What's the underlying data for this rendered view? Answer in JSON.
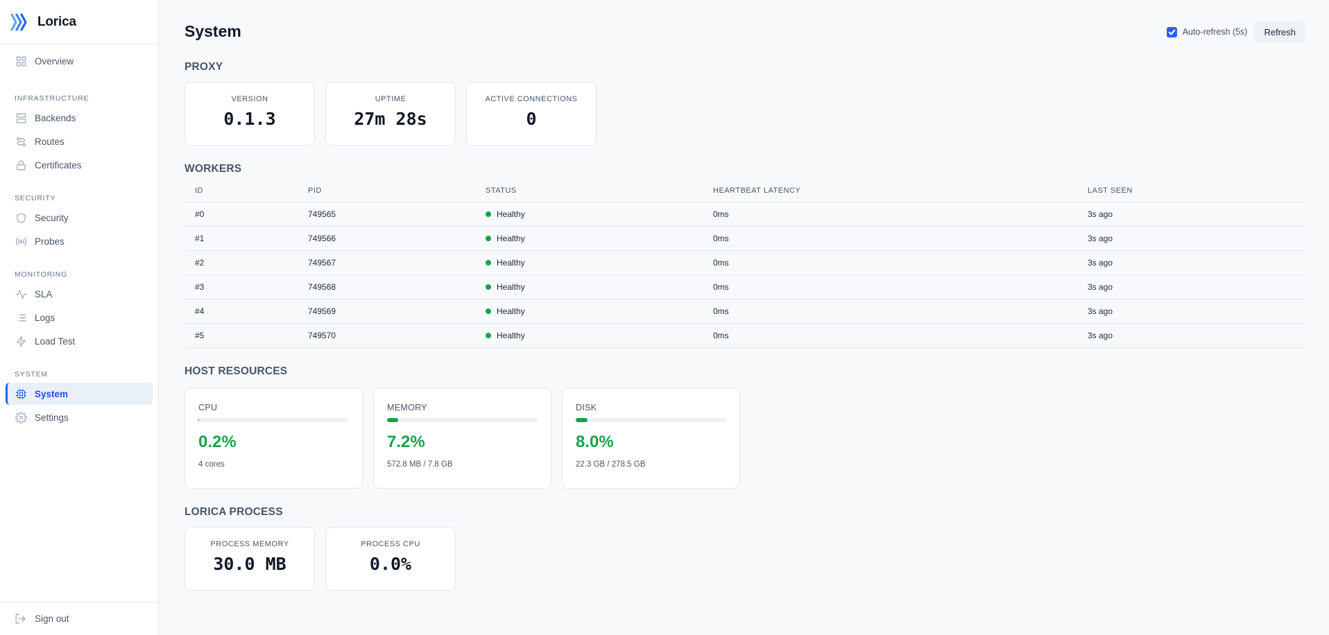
{
  "brand": {
    "name": "Lorica"
  },
  "sidebar": {
    "top": [
      {
        "label": "Overview",
        "icon": "grid-icon"
      }
    ],
    "groups": [
      {
        "label": "INFRASTRUCTURE",
        "items": [
          {
            "label": "Backends",
            "icon": "server-icon"
          },
          {
            "label": "Routes",
            "icon": "route-icon"
          },
          {
            "label": "Certificates",
            "icon": "lock-icon"
          }
        ]
      },
      {
        "label": "SECURITY",
        "items": [
          {
            "label": "Security",
            "icon": "shield-icon"
          },
          {
            "label": "Probes",
            "icon": "broadcast-icon"
          }
        ]
      },
      {
        "label": "MONITORING",
        "items": [
          {
            "label": "SLA",
            "icon": "activity-icon"
          },
          {
            "label": "Logs",
            "icon": "list-icon"
          },
          {
            "label": "Load Test",
            "icon": "bolt-icon"
          }
        ]
      },
      {
        "label": "SYSTEM",
        "items": [
          {
            "label": "System",
            "icon": "chip-icon",
            "active": true
          },
          {
            "label": "Settings",
            "icon": "gear-icon"
          }
        ]
      }
    ],
    "signout": "Sign out"
  },
  "header": {
    "title": "System",
    "auto_refresh_label": "Auto-refresh (5s)",
    "auto_refresh_checked": true,
    "refresh_label": "Refresh"
  },
  "proxy": {
    "title": "PROXY",
    "cards": [
      {
        "label": "VERSION",
        "value": "0.1.3"
      },
      {
        "label": "UPTIME",
        "value": "27m 28s"
      },
      {
        "label": "ACTIVE CONNECTIONS",
        "value": "0"
      }
    ]
  },
  "workers": {
    "title": "WORKERS",
    "columns": [
      "ID",
      "PID",
      "STATUS",
      "HEARTBEAT LATENCY",
      "LAST SEEN"
    ],
    "rows": [
      {
        "id": "#0",
        "pid": "749565",
        "status": "Healthy",
        "latency": "0ms",
        "last_seen": "3s ago"
      },
      {
        "id": "#1",
        "pid": "749566",
        "status": "Healthy",
        "latency": "0ms",
        "last_seen": "3s ago"
      },
      {
        "id": "#2",
        "pid": "749567",
        "status": "Healthy",
        "latency": "0ms",
        "last_seen": "3s ago"
      },
      {
        "id": "#3",
        "pid": "749568",
        "status": "Healthy",
        "latency": "0ms",
        "last_seen": "3s ago"
      },
      {
        "id": "#4",
        "pid": "749569",
        "status": "Healthy",
        "latency": "0ms",
        "last_seen": "3s ago"
      },
      {
        "id": "#5",
        "pid": "749570",
        "status": "Healthy",
        "latency": "0ms",
        "last_seen": "3s ago"
      }
    ],
    "status_color": "#16a34a"
  },
  "host": {
    "title": "HOST RESOURCES",
    "cards": [
      {
        "label": "CPU",
        "value": "0.2%",
        "percent": 0.2,
        "sub": "4 cores"
      },
      {
        "label": "MEMORY",
        "value": "7.2%",
        "percent": 7.2,
        "sub": "572.8 MB / 7.8 GB"
      },
      {
        "label": "DISK",
        "value": "8.0%",
        "percent": 8.0,
        "sub": "22.3 GB / 278.5 GB"
      }
    ],
    "accent": "#16a34a"
  },
  "process": {
    "title": "LORICA PROCESS",
    "cards": [
      {
        "label": "PROCESS MEMORY",
        "value": "30.0 MB"
      },
      {
        "label": "PROCESS CPU",
        "value": "0.0%"
      }
    ]
  }
}
